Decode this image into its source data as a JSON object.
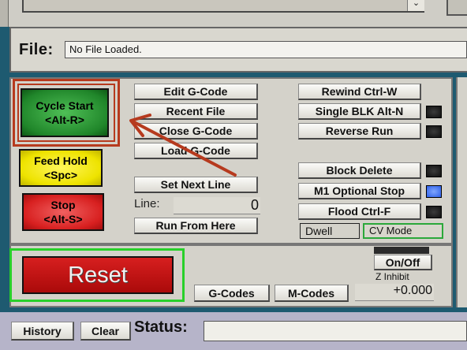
{
  "top": {
    "dropdown_arrow": "⌄"
  },
  "file": {
    "label": "File:",
    "value": "No File Loaded."
  },
  "machine": {
    "cycle_start": {
      "line1": "Cycle Start",
      "line2": "<Alt-R>"
    },
    "feed_hold": {
      "line1": "Feed Hold",
      "line2": "<Spc>"
    },
    "stop": {
      "line1": "Stop",
      "line2": "<Alt-S>"
    }
  },
  "gcode_buttons": {
    "edit": "Edit G-Code",
    "recent": "Recent File",
    "close": "Close G-Code",
    "load": "Load G-Code",
    "set_next_line": "Set Next Line",
    "run_from_here": "Run From Here"
  },
  "line": {
    "label": "Line:",
    "value": "0"
  },
  "right_buttons": {
    "rewind": "Rewind Ctrl-W",
    "single_blk": "Single BLK Alt-N",
    "reverse_run": "Reverse Run",
    "block_delete": "Block Delete",
    "m1_optional_stop": "M1 Optional Stop",
    "flood": "Flood Ctrl-F"
  },
  "modes": {
    "dwell": "Dwell",
    "cv_mode": "CV Mode"
  },
  "bottom": {
    "reset": "Reset",
    "g_codes": "G-Codes",
    "m_codes": "M-Codes",
    "on_off": "On/Off",
    "z_inhibit_label": "Z Inhibit",
    "z_inhibit_value": "+0.000"
  },
  "status": {
    "history": "History",
    "clear": "Clear",
    "label": "Status:",
    "value": ""
  },
  "colors": {
    "annotation": "#b63a1e",
    "cycle_start": "#20862a",
    "feed_hold": "#eee300",
    "stop": "#d82020",
    "reset": "#c01414",
    "led_active": "#2c5fe8"
  },
  "indicators": {
    "m1_optional_stop_led": "on",
    "single_blk_led": "off",
    "reverse_run_led": "off",
    "block_delete_led": "off",
    "flood_led": "off"
  }
}
